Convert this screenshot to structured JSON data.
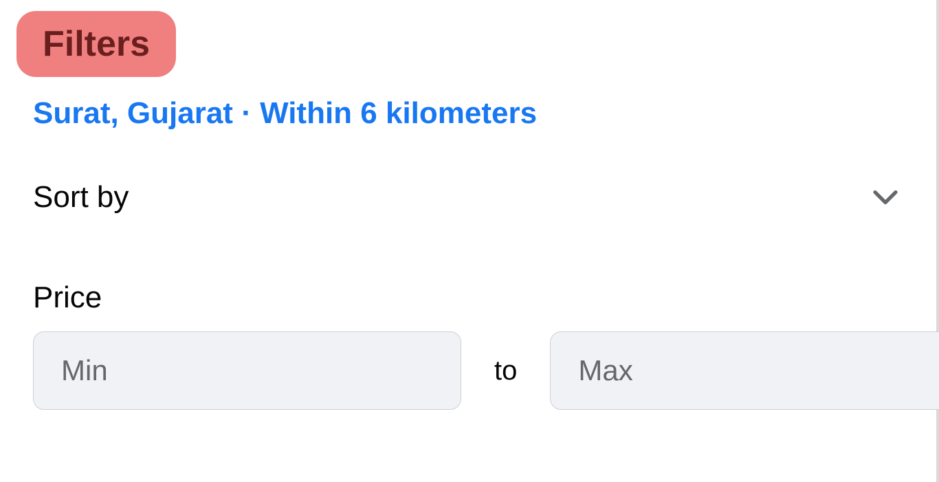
{
  "filters": {
    "title": "Filters",
    "location": "Surat, Gujarat · Within 6 kilometers",
    "sortBy": {
      "label": "Sort by"
    },
    "price": {
      "label": "Price",
      "minPlaceholder": "Min",
      "maxPlaceholder": "Max",
      "separator": "to"
    }
  }
}
